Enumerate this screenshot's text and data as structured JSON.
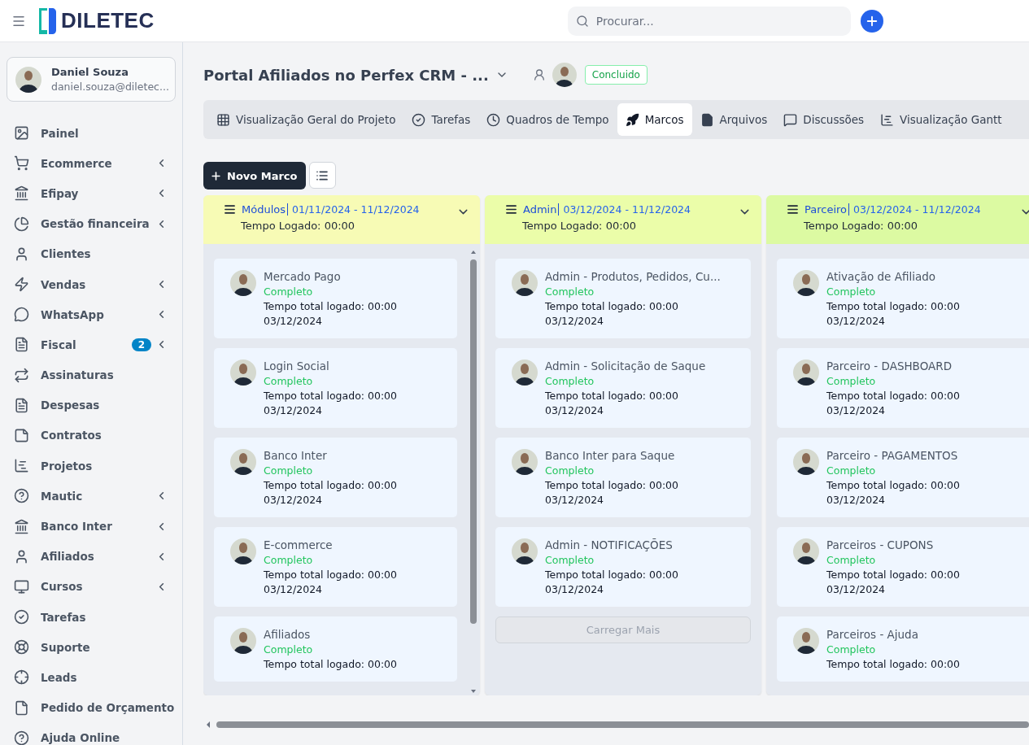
{
  "header": {
    "logo_text": "DILETEC",
    "search": {
      "placeholder": "Procurar..."
    }
  },
  "sidebar": {
    "profile": {
      "name": "Daniel Souza",
      "email": "daniel.souza@diletec..."
    },
    "items": [
      {
        "label": "Painel",
        "expandable": false
      },
      {
        "label": "Ecommerce",
        "expandable": true
      },
      {
        "label": "Efipay",
        "expandable": true
      },
      {
        "label": "Gestão financeira",
        "expandable": true
      },
      {
        "label": "Clientes",
        "expandable": false
      },
      {
        "label": "Vendas",
        "expandable": true
      },
      {
        "label": "WhatsApp",
        "expandable": true
      },
      {
        "label": "Fiscal",
        "expandable": true,
        "badge": "2"
      },
      {
        "label": "Assinaturas",
        "expandable": false
      },
      {
        "label": "Despesas",
        "expandable": false
      },
      {
        "label": "Contratos",
        "expandable": false
      },
      {
        "label": "Projetos",
        "expandable": false
      },
      {
        "label": "Mautic",
        "expandable": true
      },
      {
        "label": "Banco Inter",
        "expandable": true
      },
      {
        "label": "Afiliados",
        "expandable": true
      },
      {
        "label": "Cursos",
        "expandable": true
      },
      {
        "label": "Tarefas",
        "expandable": false
      },
      {
        "label": "Suporte",
        "expandable": false
      },
      {
        "label": "Leads",
        "expandable": false
      },
      {
        "label": "Pedido de Orçamento",
        "expandable": false
      },
      {
        "label": "Ajuda Online",
        "expandable": false
      }
    ]
  },
  "project": {
    "title": "Portal Afiliados no Perfex CRM - ...",
    "status": "Concluido"
  },
  "tabs": [
    {
      "label": "Visualização Geral do Projeto",
      "selected": false
    },
    {
      "label": "Tarefas",
      "selected": false
    },
    {
      "label": "Quadros de Tempo",
      "selected": false
    },
    {
      "label": "Marcos",
      "selected": true
    },
    {
      "label": "Arquivos",
      "selected": false
    },
    {
      "label": "Discussões",
      "selected": false
    },
    {
      "label": "Visualização Gantt",
      "selected": false
    }
  ],
  "new_button": "Novo Marco",
  "milestones": [
    {
      "name": "Módulos",
      "dates": "01/11/2024 - 11/12/2024",
      "logged": "Tempo Logado: 00:00",
      "color": "#f7fbb5",
      "scrollable": true,
      "cards": [
        {
          "title": "Mercado Pago",
          "status": "Completo",
          "total": "Tempo total logado: 00:00",
          "date": "03/12/2024"
        },
        {
          "title": "Login Social",
          "status": "Completo",
          "total": "Tempo total logado: 00:00",
          "date": "03/12/2024"
        },
        {
          "title": "Banco Inter",
          "status": "Completo",
          "total": "Tempo total logado: 00:00",
          "date": "03/12/2024"
        },
        {
          "title": "E-commerce",
          "status": "Completo",
          "total": "Tempo total logado: 00:00",
          "date": "03/12/2024"
        },
        {
          "title": "Afiliados",
          "status": "Completo",
          "total": "Tempo total logado: 00:00"
        }
      ]
    },
    {
      "name": "Admin",
      "dates": "03/12/2024 - 11/12/2024",
      "logged": "Tempo Logado: 00:00",
      "color": "#ebfda9",
      "scrollable": false,
      "load_more": "Carregar Mais",
      "cards": [
        {
          "title": "Admin - Produtos, Pedidos, Cu...",
          "status": "Completo",
          "total": "Tempo total logado: 00:00",
          "date": "03/12/2024"
        },
        {
          "title": "Admin - Solicitação de Saque",
          "status": "Completo",
          "total": "Tempo total logado: 00:00",
          "date": "03/12/2024"
        },
        {
          "title": "Banco Inter para Saque",
          "status": "Completo",
          "total": "Tempo total logado: 00:00",
          "date": "03/12/2024"
        },
        {
          "title": "Admin - NOTIFICAÇÕES",
          "status": "Completo",
          "total": "Tempo total logado: 00:00",
          "date": "03/12/2024"
        }
      ]
    },
    {
      "name": "Parceiro",
      "dates": "03/12/2024 - 11/12/2024",
      "logged": "Tempo Logado: 00:00",
      "color": "#dcfaa2",
      "scrollable": false,
      "cards": [
        {
          "title": "Ativação de Afiliado",
          "status": "Completo",
          "total": "Tempo total logado: 00:00",
          "date": "03/12/2024"
        },
        {
          "title": "Parceiro - DASHBOARD",
          "status": "Completo",
          "total": "Tempo total logado: 00:00",
          "date": "03/12/2024"
        },
        {
          "title": "Parceiro - PAGAMENTOS",
          "status": "Completo",
          "total": "Tempo total logado: 00:00",
          "date": "03/12/2024"
        },
        {
          "title": "Parceiros - CUPONS",
          "status": "Completo",
          "total": "Tempo total logado: 00:00",
          "date": "03/12/2024"
        },
        {
          "title": "Parceiros - Ajuda",
          "status": "Completo",
          "total": "Tempo total logado: 00:00"
        }
      ]
    }
  ]
}
